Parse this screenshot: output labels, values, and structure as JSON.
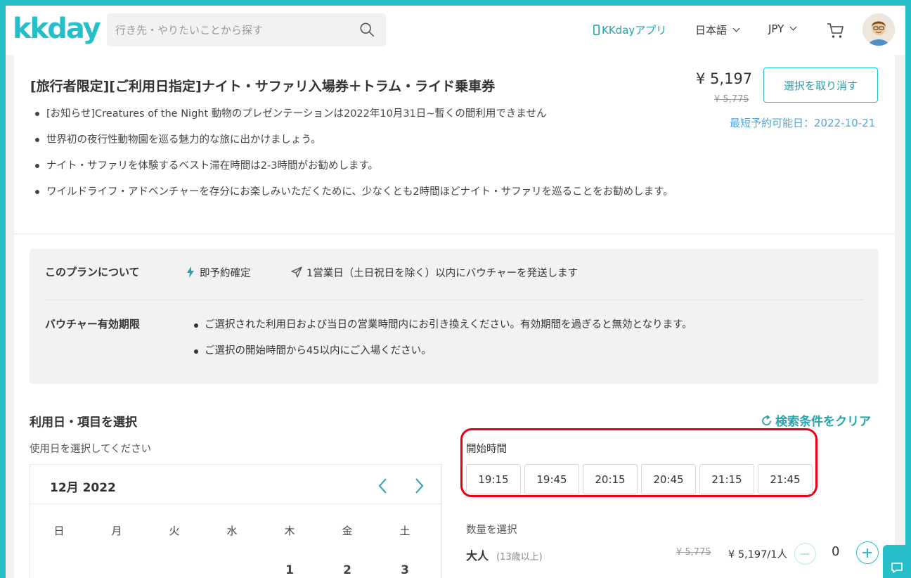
{
  "header": {
    "logo": "kkday",
    "search_placeholder": "行き先・やりたいことから探す",
    "app_link": "KKdayアプリ",
    "language": "日本語",
    "currency": "JPY"
  },
  "product": {
    "title": "[旅行者限定][ご利用日指定]ナイト・サファリ入場券＋トラム・ライド乗車券",
    "bullets": [
      "[お知らせ]Creatures of the Night 動物のプレゼンテーションは2022年10月31日~暫くの間利用できません",
      "世界初の夜行性動物園を巡る魅力的な旅に出かけましょう。",
      "ナイト・サファリを体験するベスト滞在時間は2-3時間がお勧めします。",
      "ワイルドライフ・アドベンチャーを存分にお楽しみいただくために、少なくとも2時間ほどナイト・サファリを巡ることをお勧めします。"
    ],
    "price": "¥ 5,197",
    "original_price": "¥ 5,775",
    "cancel_button": "選択を取り消す",
    "earliest_booking": "最短予約可能日：2022-10-21"
  },
  "plan": {
    "about_label": "このプランについて",
    "instant_confirm": "即予約確定",
    "voucher_send": "1営業日（土日祝日を除く）以内にバウチャーを発送します",
    "validity_label": "バウチャー有効期限",
    "validity_items": [
      "ご選択された利用日および当日の営業時間内にお引き換えください。有効期間を過ぎると無効となります。",
      "ご選択の開始時間から45以内にご入場ください。"
    ]
  },
  "selection": {
    "title": "利用日・項目を選択",
    "clear": "検索条件をクリア",
    "date_hint": "使用日を選択してください",
    "calendar": {
      "month": "12月 2022",
      "weekdays": [
        "日",
        "月",
        "火",
        "水",
        "木",
        "金",
        "土"
      ],
      "first_row": [
        "",
        "",
        "",
        "",
        "1",
        "2",
        "3"
      ]
    },
    "time_label": "開始時間",
    "times": [
      "19:15",
      "19:45",
      "20:15",
      "20:45",
      "21:15",
      "21:45"
    ],
    "quantity_label": "数量を選択",
    "adult_label": "大人",
    "adult_age": "(13歳以上)",
    "unit_original": "¥ 5,775",
    "unit_price": "¥ 5,197/1人",
    "quantity": "0"
  },
  "colors": {
    "brand": "#26bec9",
    "highlight": "#e60012",
    "link_blue": "#4fa8d8"
  }
}
